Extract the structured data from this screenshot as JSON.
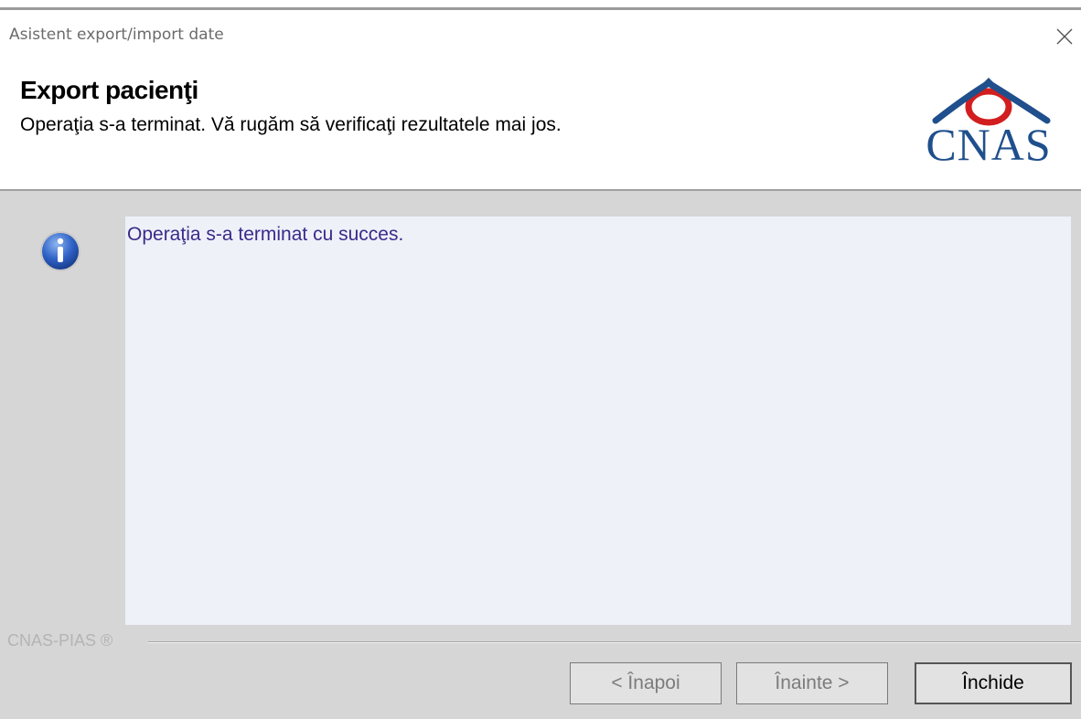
{
  "window": {
    "title": "Asistent export/import date"
  },
  "header": {
    "title": "Export pacienţi",
    "subtitle": "Operaţia s-a terminat. Vă rugăm să verificaţi rezultatele mai jos.",
    "logo_text": "CNAS"
  },
  "message": {
    "text": "Operaţia s-a terminat cu succes."
  },
  "footer": {
    "brand": "CNAS-PIAS ®"
  },
  "buttons": {
    "back_label": "< Înapoi",
    "next_label": "Înainte >",
    "close_label": "Închide"
  },
  "icons": {
    "close": "close-icon",
    "info": "info-icon",
    "logo": "cnas-logo"
  },
  "colors": {
    "logo_blue": "#1f4f8c",
    "logo_red": "#d21e1e",
    "message_text": "#3a2a8a",
    "panel_bg": "#eef1f8"
  }
}
